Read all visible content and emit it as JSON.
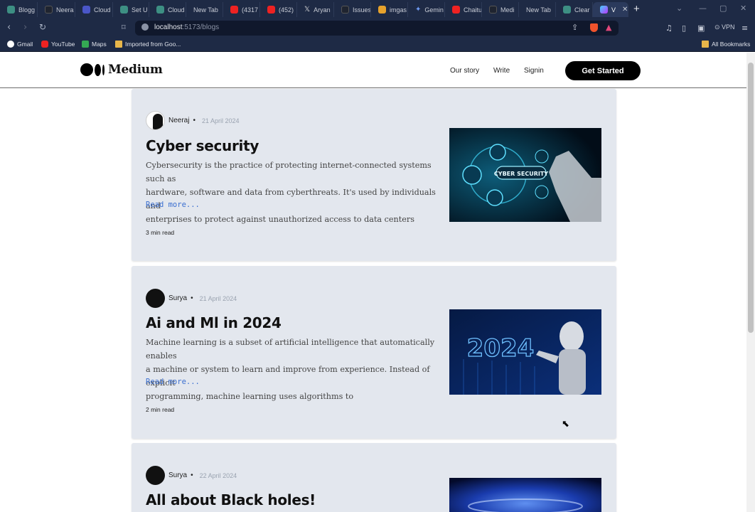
{
  "browser": {
    "tabs": [
      {
        "label": "Blogg",
        "color": "#3d8f83"
      },
      {
        "label": "Neera",
        "color": "#1f2430"
      },
      {
        "label": "Cloud",
        "color": "#4a56c7"
      },
      {
        "label": "Set U",
        "color": "#3d8f83"
      },
      {
        "label": "Cloud",
        "color": "#3d8f83"
      },
      {
        "label": "New Tab",
        "color": ""
      },
      {
        "label": "(4317",
        "color": "#e22"
      },
      {
        "label": "(452)",
        "color": "#e22"
      },
      {
        "label": "Aryan",
        "color": "#111"
      },
      {
        "label": "Issues",
        "color": "#1f2430"
      },
      {
        "label": "imgas",
        "color": "#e6a22c"
      },
      {
        "label": "Gemin",
        "color": "#4a7be7"
      },
      {
        "label": "Chaitu",
        "color": "#e22"
      },
      {
        "label": "Medi",
        "color": "#1f2430"
      },
      {
        "label": "New Tab",
        "color": ""
      },
      {
        "label": "Clear",
        "color": "#3d8f83"
      },
      {
        "label": "V",
        "color": "#9b5cd6",
        "active": true
      }
    ],
    "new_tab": "+",
    "url_host": "localhost",
    "url_rest": ":5173/blogs",
    "vpn": "VPN",
    "bookmarks": [
      "Gmail",
      "YouTube",
      "Maps",
      "Imported from Goo..."
    ],
    "all_bookmarks": "All Bookmarks"
  },
  "app": {
    "logo": "Medium",
    "nav": {
      "our_story": "Our story",
      "write": "Write",
      "signin": "Signin",
      "cta": "Get Started"
    }
  },
  "posts": [
    {
      "author": "Neeraj",
      "sep": "•",
      "date": "21 April 2024",
      "title": "Cyber security",
      "lines": [
        "Cybersecurity is the practice of protecting internet-connected systems such as",
        "hardware, software and data from cyberthreats. It's used by individuals and",
        "enterprises to protect against unauthorized access to data centers"
      ],
      "read_more": "Read more...",
      "read_time": "3 min read",
      "image_label": "CYBER SECURITY"
    },
    {
      "author": "Surya",
      "sep": "•",
      "date": "21 April 2024",
      "title": "Ai and Ml in 2024",
      "lines": [
        "Machine learning is a subset of artificial intelligence that automatically enables",
        "a machine or system to learn and improve from experience. Instead of explicit",
        "programming, machine learning uses algorithms to"
      ],
      "read_more": "Read more...",
      "read_time": "2 min read",
      "image_label": "2024"
    },
    {
      "author": "Surya",
      "sep": "•",
      "date": "22 April 2024",
      "title": "All about Black holes!"
    }
  ]
}
